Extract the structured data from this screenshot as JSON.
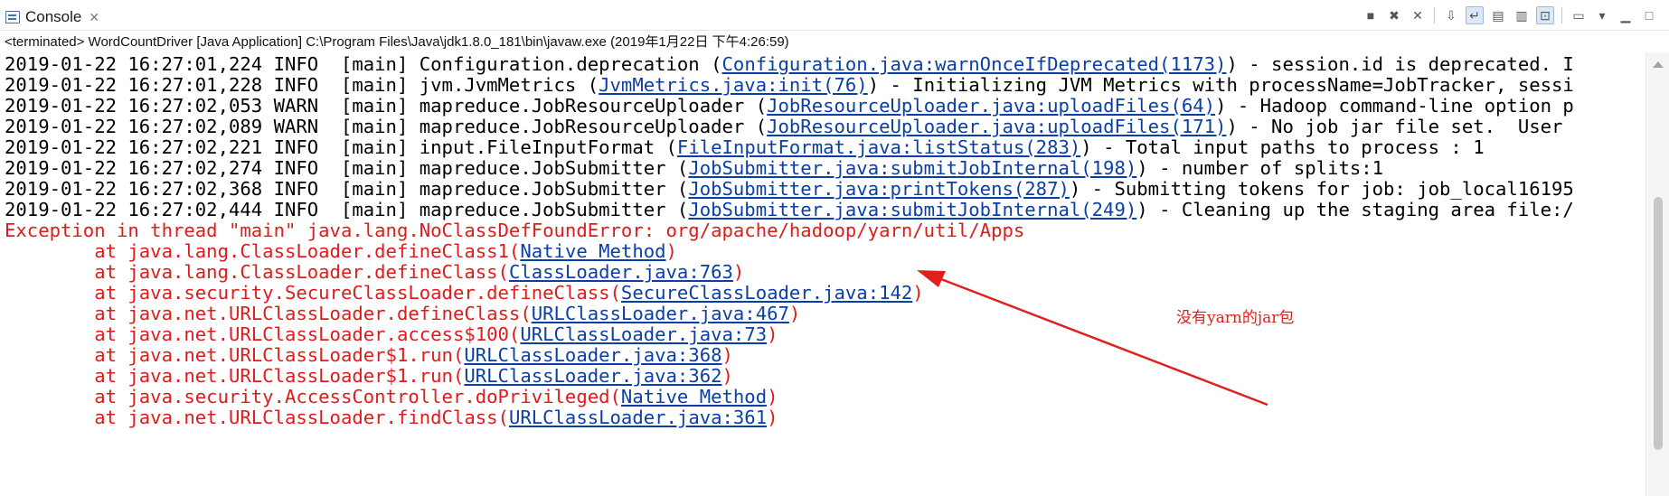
{
  "tab": {
    "title": "Console",
    "close_glyph": "✕"
  },
  "toolbar": {
    "buttons": [
      "terminate-icon",
      "remove-launch-icon",
      "remove-all-icon",
      "scroll-lock-icon",
      "word-wrap-icon",
      "show-on-stdout-icon",
      "show-on-stderr-icon",
      "pin-icon",
      "display-console-icon",
      "open-console-icon",
      "minimize-icon",
      "maximize-icon"
    ]
  },
  "status": "<terminated> WordCountDriver [Java Application] C:\\Program Files\\Java\\jdk1.8.0_181\\bin\\javaw.exe (2019年1月22日 下午4:26:59)",
  "log_lines": [
    {
      "pre": "2019-01-22 16:27:01,224 INFO  [main] Configuration.deprecation (",
      "link": "Configuration.java:warnOnceIfDeprecated(1173)",
      "post": ") - session.id is deprecated. I"
    },
    {
      "pre": "2019-01-22 16:27:01,228 INFO  [main] jvm.JvmMetrics (",
      "link": "JvmMetrics.java:init(76)",
      "post": ") - Initializing JVM Metrics with processName=JobTracker, sessi"
    },
    {
      "pre": "2019-01-22 16:27:02,053 WARN  [main] mapreduce.JobResourceUploader (",
      "link": "JobResourceUploader.java:uploadFiles(64)",
      "post": ") - Hadoop command-line option p"
    },
    {
      "pre": "2019-01-22 16:27:02,089 WARN  [main] mapreduce.JobResourceUploader (",
      "link": "JobResourceUploader.java:uploadFiles(171)",
      "post": ") - No job jar file set.  User"
    },
    {
      "pre": "2019-01-22 16:27:02,221 INFO  [main] input.FileInputFormat (",
      "link": "FileInputFormat.java:listStatus(283)",
      "post": ") - Total input paths to process : 1"
    },
    {
      "pre": "2019-01-22 16:27:02,274 INFO  [main] mapreduce.JobSubmitter (",
      "link": "JobSubmitter.java:submitJobInternal(198)",
      "post": ") - number of splits:1"
    },
    {
      "pre": "2019-01-22 16:27:02,368 INFO  [main] mapreduce.JobSubmitter (",
      "link": "JobSubmitter.java:printTokens(287)",
      "post": ") - Submitting tokens for job: job_local16195"
    },
    {
      "pre": "2019-01-22 16:27:02,444 INFO  [main] mapreduce.JobSubmitter (",
      "link": "JobSubmitter.java:submitJobInternal(249)",
      "post": ") - Cleaning up the staging area file:/"
    }
  ],
  "exception": "Exception in thread \"main\" java.lang.NoClassDefFoundError: org/apache/hadoop/yarn/util/Apps",
  "stack_lines": [
    {
      "pre": "        at java.lang.ClassLoader.defineClass1(",
      "link": "Native Method",
      "post": ")"
    },
    {
      "pre": "        at java.lang.ClassLoader.defineClass(",
      "link": "ClassLoader.java:763",
      "post": ")"
    },
    {
      "pre": "        at java.security.SecureClassLoader.defineClass(",
      "link": "SecureClassLoader.java:142",
      "post": ")"
    },
    {
      "pre": "        at java.net.URLClassLoader.defineClass(",
      "link": "URLClassLoader.java:467",
      "post": ")"
    },
    {
      "pre": "        at java.net.URLClassLoader.access$100(",
      "link": "URLClassLoader.java:73",
      "post": ")"
    },
    {
      "pre": "        at java.net.URLClassLoader$1.run(",
      "link": "URLClassLoader.java:368",
      "post": ")"
    },
    {
      "pre": "        at java.net.URLClassLoader$1.run(",
      "link": "URLClassLoader.java:362",
      "post": ")"
    },
    {
      "pre": "        at java.security.AccessController.doPrivileged(",
      "link": "Native Method",
      "post": ")"
    },
    {
      "pre": "        at java.net.URLClassLoader.findClass(",
      "link": "URLClassLoader.java:361",
      "post": ")"
    }
  ],
  "annotation": {
    "text": "没有yarn的jar包",
    "color": "#e0201c"
  },
  "colors": {
    "error": "#e01b1b",
    "link": "#0b3fa8",
    "text": "#000000"
  }
}
